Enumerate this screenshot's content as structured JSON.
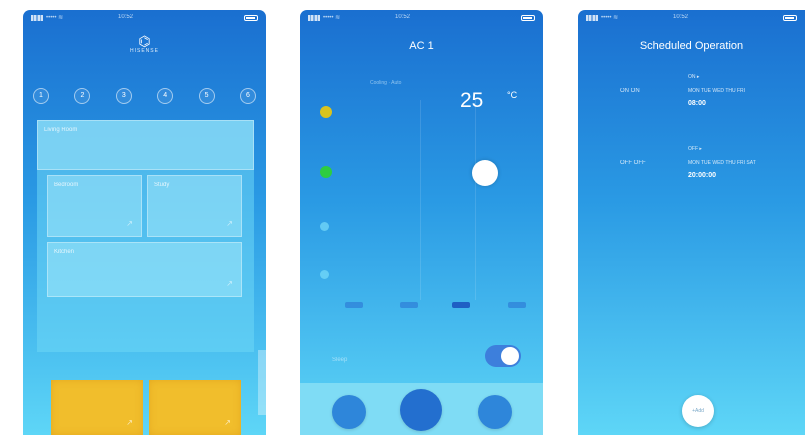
{
  "status": {
    "carrier": "••••• ≋",
    "time": "10:52"
  },
  "phone1": {
    "logo_word": "HISENSE",
    "tabs": [
      "1",
      "2",
      "3",
      "4",
      "5",
      "6"
    ],
    "zones": [
      "Living Room",
      "Bedroom",
      "Study",
      "Kitchen"
    ]
  },
  "phone2": {
    "title": "AC 1",
    "mode_caption": "Cooling · Auto",
    "temperature": "25",
    "unit": "°C",
    "toggle_label": "Sleep",
    "fan_levels": 4
  },
  "phone3": {
    "title": "Scheduled Operation",
    "items": [
      {
        "left": "ON  ON",
        "sub": "MON TUE WED THU FRI",
        "time": "08:00"
      },
      {
        "left": "OFF OFF",
        "sub": "MON TUE WED THU FRI SAT",
        "time": "20:00:00"
      }
    ],
    "fab_label": "+Add"
  },
  "colors": {
    "accent": "#2e86da",
    "yellow": "#f1be2c",
    "green": "#2ecc40",
    "amber": "#d9c31e"
  }
}
